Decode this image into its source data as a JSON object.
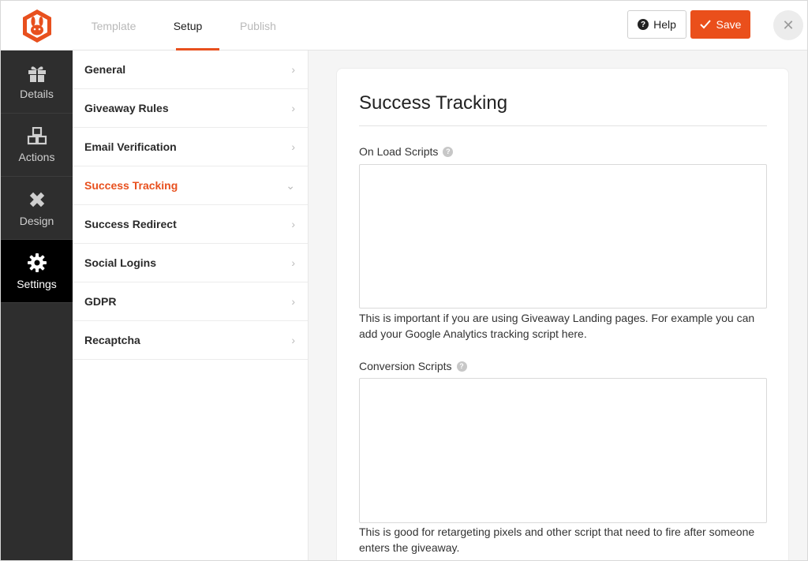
{
  "topbar": {
    "tabs": [
      "Template",
      "Setup",
      "Publish"
    ],
    "help_label": "Help",
    "save_label": "Save",
    "close_symbol": "✕"
  },
  "leftnav": {
    "items": [
      {
        "label": "Details",
        "icon": "gift-icon"
      },
      {
        "label": "Actions",
        "icon": "boxes-icon"
      },
      {
        "label": "Design",
        "icon": "pencil-ruler-icon"
      },
      {
        "label": "Settings",
        "icon": "gear-icon"
      }
    ]
  },
  "menu": {
    "items": [
      {
        "label": "General",
        "chevron": "›"
      },
      {
        "label": "Giveaway Rules",
        "chevron": "›"
      },
      {
        "label": "Email Verification",
        "chevron": "›"
      },
      {
        "label": "Success Tracking",
        "chevron": "⌄"
      },
      {
        "label": "Success Redirect",
        "chevron": "›"
      },
      {
        "label": "Social Logins",
        "chevron": "›"
      },
      {
        "label": "GDPR",
        "chevron": "›"
      },
      {
        "label": "Recaptcha",
        "chevron": "›"
      }
    ]
  },
  "panel": {
    "title": "Success Tracking",
    "onload": {
      "label": "On Load Scripts",
      "value": "",
      "help": "This is important if you are using Giveaway Landing pages. For example you can add your Google Analytics tracking script here."
    },
    "conversion": {
      "label": "Conversion Scripts",
      "value": "",
      "help": "This is good for retargeting pixels and other script that need to fire after someone enters the giveaway."
    },
    "help_symbol": "?"
  },
  "colors": {
    "accent": "#e8501e",
    "nav_bg": "#2e2e2e",
    "nav_active": "#000000"
  }
}
